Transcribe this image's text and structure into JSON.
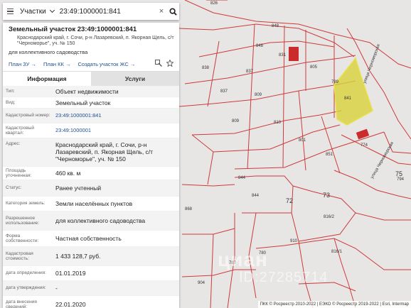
{
  "search": {
    "layer_label": "Участки",
    "query": "23:49:1000001:841",
    "clear_glyph": "×"
  },
  "card": {
    "title": "Земельный участок 23:49:1000001:841",
    "address": "Краснодарский край, г. Сочи, р-н Лазаревский, п. Якорная Щель, с/т \"Черноморье\", уч. № 150",
    "purpose": "для коллективного садоводства",
    "actions": [
      "План ЗУ →",
      "План КК →",
      "Создать участок ЖС →"
    ]
  },
  "tabs": [
    {
      "label": "Информация",
      "active": true
    },
    {
      "label": "Услуги",
      "active": false
    }
  ],
  "details": [
    {
      "label": "Тип:",
      "value": "Объект недвижимости",
      "link": false
    },
    {
      "label": "Вид:",
      "value": "Земельный участок",
      "link": false
    },
    {
      "label": "Кадастровый номер:",
      "value": "23:49:1000001:841",
      "link": true
    },
    {
      "label": "Кадастровый квартал:",
      "value": "23:49:1000001",
      "link": true
    },
    {
      "label": "Адрес:",
      "value": "Краснодарский край, г. Сочи, р-н Лазаревский, п. Якорная Щель, с/т \"Черноморье\", уч. № 150",
      "link": false
    },
    {
      "label": "Площадь уточненная:",
      "value": "460 кв. м",
      "link": false
    },
    {
      "label": "Статус:",
      "value": "Ранее учтенный",
      "link": false
    },
    {
      "label": "Категория земель:",
      "value": "Земли населённых пунктов",
      "link": false
    },
    {
      "label": "Разрешенное использование:",
      "value": "для коллективного садоводства",
      "link": false
    },
    {
      "label": "Форма собственности:",
      "value": "Частная собственность",
      "link": false
    },
    {
      "label": "Кадастровая стоимость:",
      "value": "1 433 128,7 руб.",
      "link": false
    },
    {
      "label": "дата определения:",
      "value": "01.01.2019",
      "link": false
    },
    {
      "label": "дата утверждения:",
      "value": "-",
      "link": false
    },
    {
      "label": "дата внесения сведений:",
      "value": "22.01.2020",
      "link": false
    }
  ],
  "map": {
    "parcel_labels": [
      "826",
      "848",
      "848",
      "831",
      "805",
      "838",
      "837",
      "809",
      "789",
      "841",
      "810",
      "809",
      "801",
      "851",
      "774",
      "844",
      "72",
      "73",
      "75",
      "794",
      "816/2",
      "868",
      "910",
      "780",
      "780",
      "816/1",
      "904"
    ],
    "street_labels": [
      "улица Черноморская",
      "улица Черноморская"
    ],
    "highlight_color": "#d8d23a",
    "line_color": "#cc3b3b",
    "building_color": "#cc2b2b"
  },
  "watermark": {
    "brand": "циан",
    "id": "ID:27285714"
  },
  "copyright": "ПКК © Росреестр 2010-2022 | ЕЭКО © Росреестр 2019-2022 | Esri, Intermap"
}
